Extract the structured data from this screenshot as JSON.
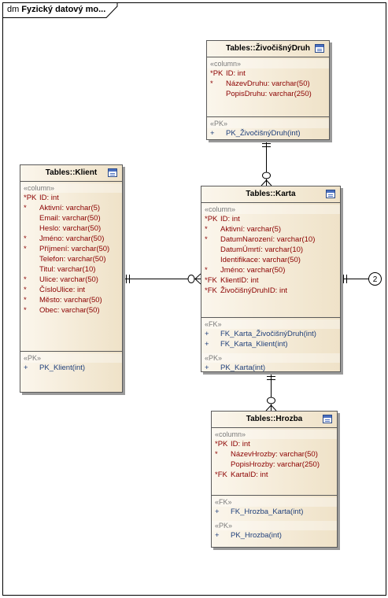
{
  "diagram": {
    "kind_label": "dm",
    "title": "Fyzický datový mo..."
  },
  "entities": {
    "zivocisny": {
      "title": "Tables::ŽivočišnýDruh",
      "stereo_columns": "«column»",
      "columns": [
        {
          "prefix": "*PK",
          "text": "ID:  int"
        },
        {
          "prefix": "*",
          "text": "NázevDruhu:  varchar(50)"
        },
        {
          "prefix": "",
          "text": "PopisDruhu:  varchar(250)"
        }
      ],
      "stereo_pk": "«PK»",
      "pk_ops": [
        {
          "prefix": "+",
          "text": "PK_ŽivočišnýDruh(int)"
        }
      ]
    },
    "klient": {
      "title": "Tables::Klient",
      "stereo_columns": "«column»",
      "columns": [
        {
          "prefix": "*PK",
          "text": "ID:  int"
        },
        {
          "prefix": "*",
          "text": "Aktivní:  varchar(5)"
        },
        {
          "prefix": "",
          "text": "Email:  varchar(50)"
        },
        {
          "prefix": "",
          "text": "Heslo:  varchar(50)"
        },
        {
          "prefix": "*",
          "text": "Jméno:  varchar(50)"
        },
        {
          "prefix": "*",
          "text": "Příjmení:  varchar(50)"
        },
        {
          "prefix": "",
          "text": "Telefon:  varchar(50)"
        },
        {
          "prefix": "",
          "text": "Titul:  varchar(10)"
        },
        {
          "prefix": "*",
          "text": "Ulice:  varchar(50)"
        },
        {
          "prefix": "*",
          "text": "ČísloUlice:  int"
        },
        {
          "prefix": "*",
          "text": "Město:  varchar(50)"
        },
        {
          "prefix": "*",
          "text": "Obec:  varchar(50)"
        }
      ],
      "stereo_pk": "«PK»",
      "pk_ops": [
        {
          "prefix": "+",
          "text": "PK_Klient(int)"
        }
      ]
    },
    "karta": {
      "title": "Tables::Karta",
      "stereo_columns": "«column»",
      "columns": [
        {
          "prefix": "*PK",
          "text": "ID:  int"
        },
        {
          "prefix": "*",
          "text": "Aktivní:  varchar(5)"
        },
        {
          "prefix": "*",
          "text": "DatumNarození:  varchar(10)"
        },
        {
          "prefix": "",
          "text": "DatumÚmrtí:  varchar(10)"
        },
        {
          "prefix": "",
          "text": "Identifikace:  varchar(50)"
        },
        {
          "prefix": "*",
          "text": "Jméno:  varchar(50)"
        },
        {
          "prefix": "*FK",
          "text": "KlientID:  int"
        },
        {
          "prefix": "*FK",
          "text": "ŽivočišnýDruhID:  int"
        }
      ],
      "stereo_fk": "«FK»",
      "fk_ops": [
        {
          "prefix": "+",
          "text": "FK_Karta_ŽivočišnýDruh(int)"
        },
        {
          "prefix": "+",
          "text": "FK_Karta_Klient(int)"
        }
      ],
      "stereo_pk": "«PK»",
      "pk_ops": [
        {
          "prefix": "+",
          "text": "PK_Karta(int)"
        }
      ]
    },
    "hrozba": {
      "title": "Tables::Hrozba",
      "stereo_columns": "«column»",
      "columns": [
        {
          "prefix": "*PK",
          "text": "ID:  int"
        },
        {
          "prefix": "*",
          "text": "NázevHrozby:  varchar(50)"
        },
        {
          "prefix": "",
          "text": "PopisHrozby:  varchar(250)"
        },
        {
          "prefix": "*FK",
          "text": "KartaID:  int"
        }
      ],
      "stereo_fk": "«FK»",
      "fk_ops": [
        {
          "prefix": "+",
          "text": "FK_Hrozba_Karta(int)"
        }
      ],
      "stereo_pk": "«PK»",
      "pk_ops": [
        {
          "prefix": "+",
          "text": "PK_Hrozba(int)"
        }
      ]
    }
  },
  "offpage_connector": "2"
}
